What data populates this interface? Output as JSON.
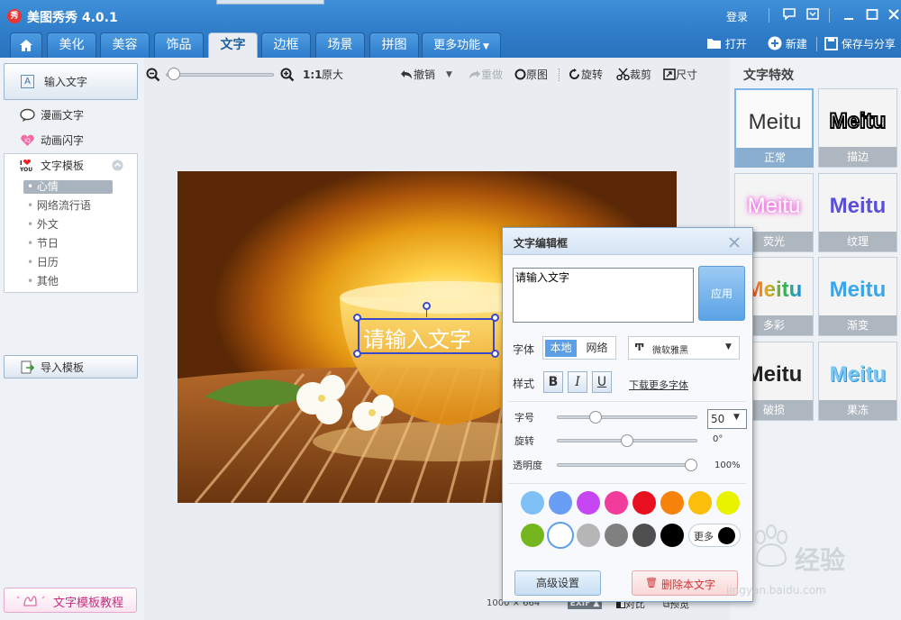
{
  "app": {
    "title": "美图秀秀 4.0.1",
    "login": "登录"
  },
  "nav": {
    "tabs": [
      {
        "label": "美化"
      },
      {
        "label": "美容"
      },
      {
        "label": "饰品"
      },
      {
        "label": "文字"
      },
      {
        "label": "边框"
      },
      {
        "label": "场景"
      },
      {
        "label": "拼图"
      },
      {
        "label": "更多功能"
      }
    ],
    "open": "打开",
    "new": "新建",
    "save_share": "保存与分享"
  },
  "left": {
    "input_text": "输入文字",
    "comic_text": "漫画文字",
    "animated_text": "动画闪字",
    "template": "文字模板",
    "template_items": [
      "心情",
      "网络流行语",
      "外文",
      "节日",
      "日历",
      "其他"
    ],
    "import_template": "导入模板",
    "tutorial": "文字模板教程"
  },
  "toolbar": {
    "zoom_ratio": "1:1",
    "original_size": "原大",
    "undo": "撤销",
    "redo": "重做",
    "original": "原图",
    "rotate": "旋转",
    "crop": "裁剪",
    "size": "尺寸",
    "zoom_level": 0.02
  },
  "canvas": {
    "overlay_text": "请输入文字",
    "dimensions": "1000 × 664",
    "exif": "EXIF",
    "compare": "对比",
    "preview": "预览"
  },
  "effects": {
    "title": "文字特效",
    "items": [
      {
        "word": "Meitu",
        "label": "正常"
      },
      {
        "word": "Meitu",
        "label": "描边"
      },
      {
        "word": "Meitu",
        "label": "荧光"
      },
      {
        "word": "Meitu",
        "label": "纹理"
      },
      {
        "word": "Meitu",
        "label": "多彩"
      },
      {
        "word": "Meitu",
        "label": "渐变"
      },
      {
        "word": "Meitu",
        "label": "破损"
      },
      {
        "word": "Meitu",
        "label": "果冻"
      }
    ]
  },
  "dialog": {
    "title": "文字编辑框",
    "text_value": "请输入文字",
    "apply": "应用",
    "font_label": "字体",
    "font_local": "本地",
    "font_web": "网络",
    "font_name": "微软雅黑",
    "style_label": "样式",
    "bold": "B",
    "italic": "I",
    "underline": "U",
    "download_fonts": "下载更多字体",
    "size_label": "字号",
    "size_value": "50",
    "rotate_label": "旋转",
    "rotate_value": "0°",
    "opacity_label": "透明度",
    "opacity_value": "100%",
    "size_slider": 0.25,
    "rotate_slider": 0.5,
    "opacity_slider": 1.0,
    "colors": [
      "#7fc0f7",
      "#6a9ef5",
      "#c647f2",
      "#f23c9b",
      "#e8101f",
      "#f7820c",
      "#fbbe0a",
      "#e9f300",
      "#75b51e",
      "#ffffff",
      "#b6b6b6",
      "#808080",
      "#4f4f4f",
      "#000000"
    ],
    "more": "更多",
    "current_color": "#000000",
    "advanced": "高级设置",
    "delete_text": "删除本文字"
  },
  "watermark": {
    "site": "jingyan.baidu.com",
    "brand": "经验"
  }
}
